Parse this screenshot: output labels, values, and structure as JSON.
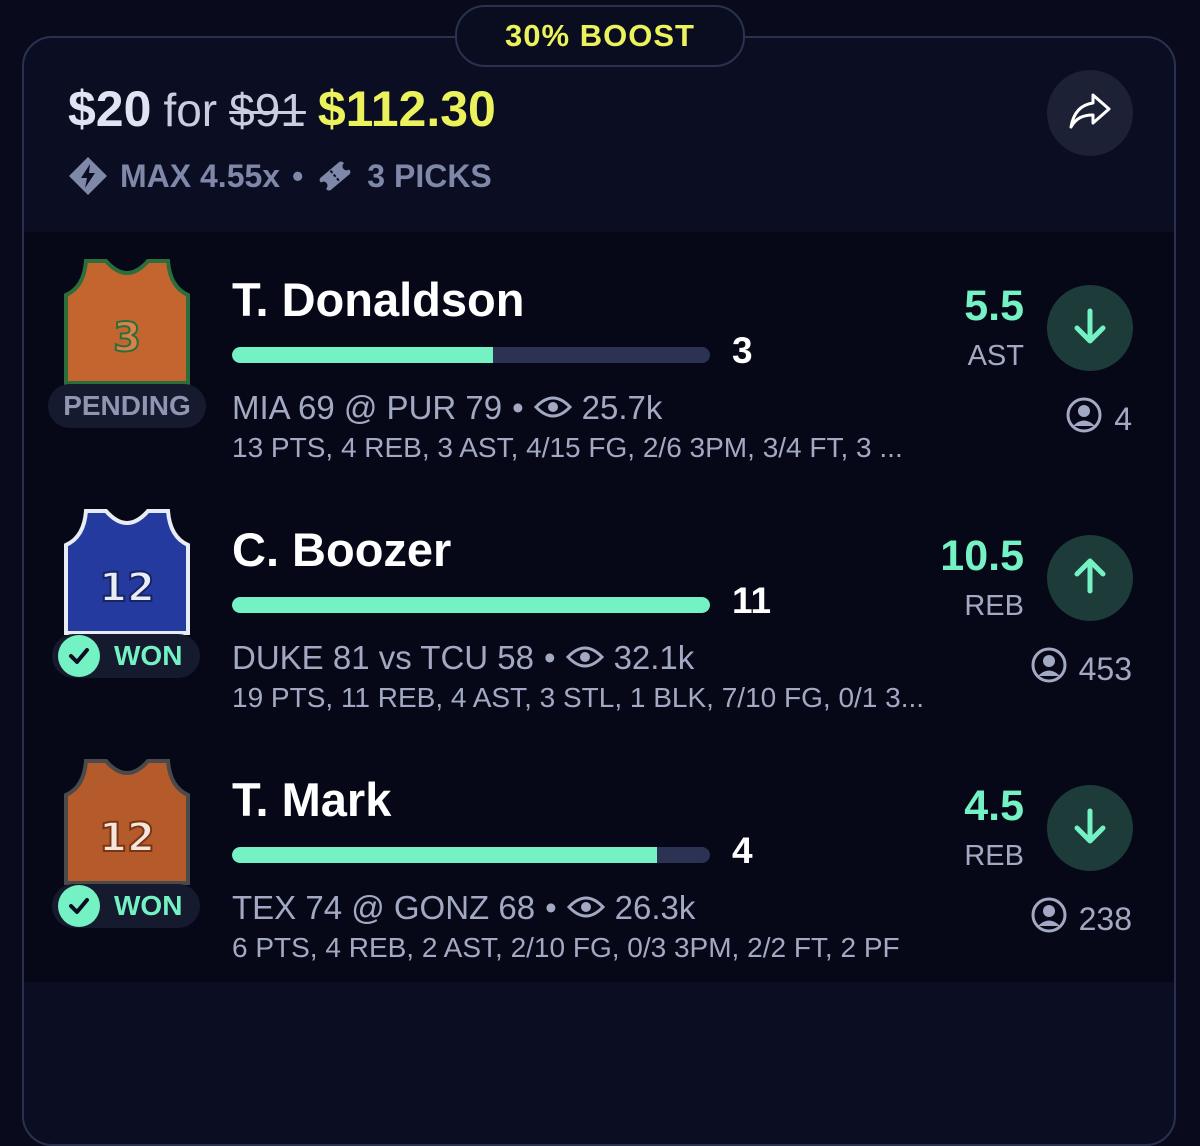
{
  "boost_label": "30% BOOST",
  "header": {
    "stake": "$20",
    "for_word": "for",
    "old_payout": "$91",
    "new_payout": "$112.30",
    "max_multiplier": "MAX 4.55x",
    "separator": "•",
    "picks_count": "3 PICKS"
  },
  "icons": {
    "max": "diamond-bolt-icon",
    "picks": "ticket-icon",
    "share": "share-arrow-icon",
    "views": "eye-icon",
    "user": "user-circle-icon",
    "check": "check-icon"
  },
  "colors": {
    "accent_green": "#74f2c4",
    "accent_yellow": "#ecf25b",
    "muted": "#a3a9c2"
  },
  "picks": [
    {
      "player": "T. Donaldson",
      "actual": "3",
      "progress": 0.546,
      "line_value": "5.5",
      "line_stat": "AST",
      "direction": "down",
      "status": "PENDING",
      "game_score": "MIA 69 @ PUR 79",
      "views": "25.7k",
      "stats": "13 PTS, 4 REB, 3 AST, 4/15 FG, 2/6 3PM, 3/4 FT, 3 ...",
      "pick_count": "4",
      "jersey": {
        "color": "orange",
        "number": "3"
      }
    },
    {
      "player": "C. Boozer",
      "actual": "11",
      "progress": 1.0,
      "line_value": "10.5",
      "line_stat": "REB",
      "direction": "up",
      "status": "WON",
      "game_score": "DUKE 81 vs TCU 58",
      "views": "32.1k",
      "stats": "19 PTS, 11 REB, 4 AST, 3 STL, 1 BLK, 7/10 FG, 0/1 3...",
      "pick_count": "453",
      "jersey": {
        "color": "blue",
        "number": "12"
      }
    },
    {
      "player": "T. Mark",
      "actual": "4",
      "progress": 0.889,
      "line_value": "4.5",
      "line_stat": "REB",
      "direction": "down",
      "status": "WON",
      "game_score": "TEX 74 @ GONZ 68",
      "views": "26.3k",
      "stats": "6 PTS, 4 REB, 2 AST, 2/10 FG, 0/3 3PM, 2/2 FT, 2 PF",
      "pick_count": "238",
      "jersey": {
        "color": "orange",
        "number": "12"
      }
    }
  ]
}
